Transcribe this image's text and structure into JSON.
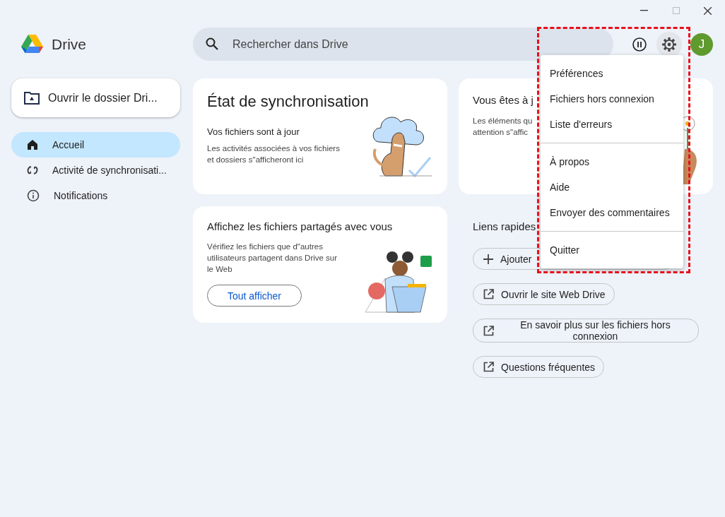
{
  "app": {
    "name": "Drive"
  },
  "search": {
    "placeholder": "Rechercher dans Drive"
  },
  "account": {
    "initial": "J"
  },
  "sidebar": {
    "open_folder_button": "Ouvrir le dossier Dri...",
    "items": [
      {
        "label": "Accueil",
        "selected": true
      },
      {
        "label": "Activité de synchronisati...",
        "selected": false
      },
      {
        "label": "Notifications",
        "selected": false
      }
    ]
  },
  "sync_card": {
    "title": "État de synchronisation",
    "subtitle": "Vos fichiers sont à jour",
    "text": "Les activités associées à vos fichiers et dossiers s\"afficheront ici"
  },
  "attention_card": {
    "title": "Vous êtes à j",
    "text_lines": [
      "Les éléments qu",
      "attention s\"affic"
    ]
  },
  "shared_card": {
    "title": "Affichez les fichiers partagés avec vous",
    "text": "Vérifiez les fichiers que d\"autres utilisateurs partagent dans Drive sur le Web",
    "button": "Tout afficher"
  },
  "quick_links": {
    "title": "Liens rapides",
    "links": [
      {
        "label": "Ajouter",
        "kind": "add"
      },
      {
        "label": "Ouvrir le site Web Drive",
        "kind": "external"
      },
      {
        "label": "En savoir plus sur les fichiers hors connexion",
        "kind": "external"
      },
      {
        "label": "Questions fréquentes",
        "kind": "external"
      }
    ]
  },
  "settings_menu": {
    "groups": [
      [
        "Préférences",
        "Fichiers hors connexion",
        "Liste d'erreurs"
      ],
      [
        "À propos",
        "Aide",
        "Envoyer des commentaires"
      ],
      [
        "Quitter"
      ]
    ]
  }
}
